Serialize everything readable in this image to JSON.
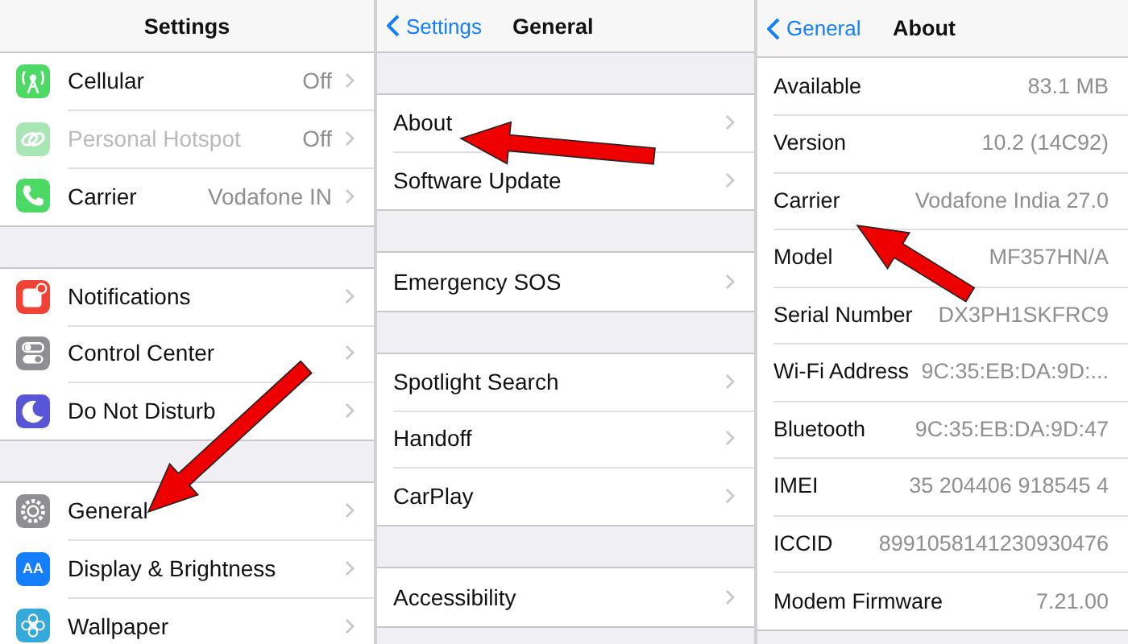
{
  "panels": [
    {
      "nav": {
        "title": "Settings"
      },
      "top_gap": false,
      "sections": [
        {
          "rows": [
            {
              "label": "Cellular",
              "value": "Off",
              "chevron": true,
              "disabled": false,
              "icon": {
                "kind": "antenna",
                "color": "#4cd964"
              }
            },
            {
              "label": "Personal Hotspot",
              "value": "Off",
              "chevron": true,
              "disabled": true,
              "icon": {
                "kind": "link",
                "color": "#a8e6b5"
              }
            },
            {
              "label": "Carrier",
              "value": "Vodafone IN",
              "chevron": true,
              "disabled": false,
              "icon": {
                "kind": "phone",
                "color": "#4cd964"
              }
            }
          ]
        },
        {
          "rows": [
            {
              "label": "Notifications",
              "chevron": true,
              "disabled": false,
              "icon": {
                "kind": "notice",
                "color": "#f04336"
              }
            },
            {
              "label": "Control Center",
              "chevron": true,
              "disabled": false,
              "icon": {
                "kind": "toggles",
                "color": "#8e8e93"
              }
            },
            {
              "label": "Do Not Disturb",
              "chevron": true,
              "disabled": false,
              "icon": {
                "kind": "moon",
                "color": "#5856d6"
              }
            }
          ]
        },
        {
          "rows": [
            {
              "label": "General",
              "chevron": true,
              "disabled": false,
              "icon": {
                "kind": "gear",
                "color": "#8e8e93"
              }
            },
            {
              "label": "Display & Brightness",
              "chevron": true,
              "disabled": false,
              "icon": {
                "kind": "glyph",
                "glyph": "AA",
                "color": "#147efb"
              }
            },
            {
              "label": "Wallpaper",
              "chevron": true,
              "disabled": false,
              "icon": {
                "kind": "flower",
                "color": "#34aadc"
              }
            }
          ]
        }
      ]
    },
    {
      "nav": {
        "back": "Settings",
        "title": "General"
      },
      "top_gap": true,
      "sections": [
        {
          "rows": [
            {
              "label": "About",
              "chevron": true
            },
            {
              "label": "Software Update",
              "chevron": true
            }
          ]
        },
        {
          "rows": [
            {
              "label": "Emergency SOS",
              "chevron": true
            }
          ]
        },
        {
          "rows": [
            {
              "label": "Spotlight Search",
              "chevron": true
            },
            {
              "label": "Handoff",
              "chevron": true
            },
            {
              "label": "CarPlay",
              "chevron": true
            }
          ]
        },
        {
          "rows": [
            {
              "label": "Accessibility",
              "chevron": true
            }
          ]
        }
      ]
    },
    {
      "nav": {
        "back": "General",
        "title": "About"
      },
      "top_gap": false,
      "sections": [
        {
          "rows": [
            {
              "label": "Available",
              "value": "83.1 MB",
              "chevron": false
            },
            {
              "label": "Version",
              "value": "10.2 (14C92)",
              "chevron": false
            },
            {
              "label": "Carrier",
              "value": "Vodafone India 27.0",
              "chevron": false
            },
            {
              "label": "Model",
              "value": "MF357HN/A",
              "chevron": false
            },
            {
              "label": "Serial Number",
              "value": "DX3PH1SKFRC9",
              "chevron": false
            },
            {
              "label": "Wi-Fi Address",
              "value": "9C:35:EB:DA:9D:...",
              "chevron": false
            },
            {
              "label": "Bluetooth",
              "value": "9C:35:EB:DA:9D:47",
              "chevron": false
            },
            {
              "label": "IMEI",
              "value": "35 204406 918545 4",
              "chevron": false
            },
            {
              "label": "ICCID",
              "value": "8991058141230930476",
              "chevron": false
            },
            {
              "label": "Modem Firmware",
              "value": "7.21.00",
              "chevron": false
            }
          ]
        }
      ]
    }
  ]
}
